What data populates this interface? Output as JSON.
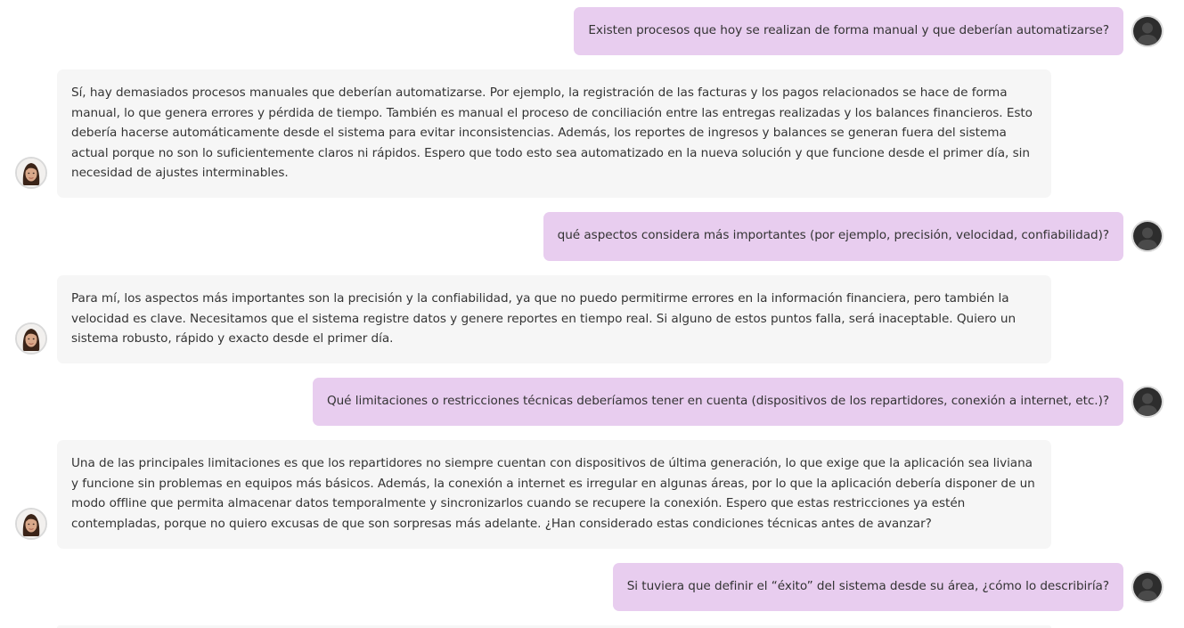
{
  "chat": {
    "messages": [
      {
        "role": "user",
        "text": "Existen procesos que hoy se realizan de forma manual y que deberían automatizarse?"
      },
      {
        "role": "assistant",
        "text": "Sí, hay demasiados procesos manuales que deberían automatizarse. Por ejemplo, la registración de las facturas y los pagos relacionados se hace de forma manual, lo que genera errores y pérdida de tiempo. También es manual el proceso de conciliación entre las entregas realizadas y los balances financieros. Esto debería hacerse automáticamente desde el sistema para evitar inconsistencias. Además, los reportes de ingresos y balances se generan fuera del sistema actual porque no son lo suficientemente claros ni rápidos. Espero que todo esto sea automatizado en la nueva solución y que funcione desde el primer día, sin necesidad de ajustes interminables."
      },
      {
        "role": "user",
        "text": "qué aspectos considera más importantes (por ejemplo, precisión, velocidad, confiabilidad)?"
      },
      {
        "role": "assistant",
        "text": "Para mí, los aspectos más importantes son la precisión y la confiabilidad, ya que no puedo permitirme errores en la información financiera, pero también la velocidad es clave. Necesitamos que el sistema registre datos y genere reportes en tiempo real. Si alguno de estos puntos falla, será inaceptable. Quiero un sistema robusto, rápido y exacto desde el primer día."
      },
      {
        "role": "user",
        "text": "Qué limitaciones o restricciones técnicas deberíamos tener en cuenta (dispositivos de los repartidores, conexión a internet, etc.)?"
      },
      {
        "role": "assistant",
        "text": "Una de las principales limitaciones es que los repartidores no siempre cuentan con dispositivos de última generación, lo que exige que la aplicación sea liviana y funcione sin problemas en equipos más básicos. Además, la conexión a internet es irregular en algunas áreas, por lo que la aplicación debería disponer de un modo offline que permita almacenar datos temporalmente y sincronizarlos cuando se recupere la conexión. Espero que estas restricciones ya estén contempladas, porque no quiero excusas de que son sorpresas más adelante. ¿Han considerado estas condiciones técnicas antes de avanzar?"
      },
      {
        "role": "user",
        "text": "Si tuviera que definir el “éxito” del sistema desde su área, ¿cómo lo describiría?"
      }
    ],
    "icons": {
      "user_avatar": "user-silhouette-icon",
      "assistant_avatar": "assistant-portrait-avatar"
    },
    "colors": {
      "user_bubble": "#e8cdef",
      "assistant_bubble": "#f6f6f6",
      "text": "#333333"
    }
  }
}
